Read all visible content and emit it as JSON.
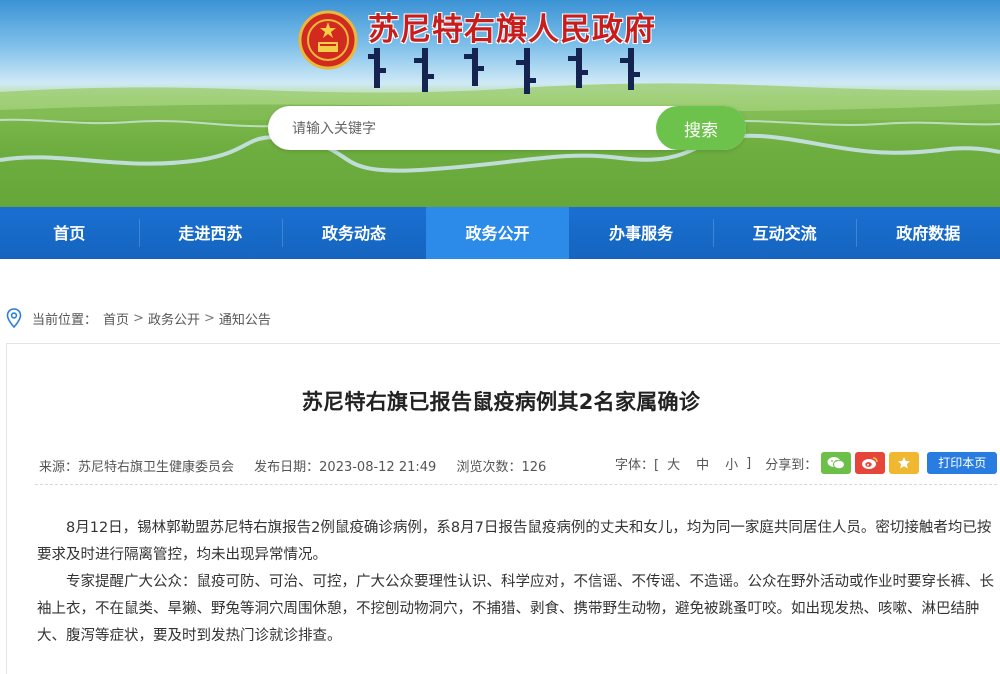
{
  "site": {
    "title": "苏尼特右旗人民政府"
  },
  "search": {
    "placeholder": "请输入关键字",
    "button_label": "搜索"
  },
  "nav": {
    "items": [
      {
        "label": "首页"
      },
      {
        "label": "走进西苏"
      },
      {
        "label": "政务动态"
      },
      {
        "label": "政务公开"
      },
      {
        "label": "办事服务"
      },
      {
        "label": "互动交流"
      },
      {
        "label": "政府数据"
      }
    ],
    "active_index": 3
  },
  "breadcrumb": {
    "prefix": "当前位置：",
    "items": [
      "首页",
      "政务公开",
      "通知公告"
    ],
    "separator": ">"
  },
  "article": {
    "title": "苏尼特右旗已报告鼠疫病例其2名家属确诊",
    "source": "来源：苏尼特右旗卫生健康委员会",
    "publish_date": "发布日期：2023-08-12 21:49",
    "views": "浏览次数：126",
    "font_label": "字体：[",
    "font_sizes": [
      "大",
      "中",
      "小"
    ],
    "font_close": "]",
    "share_label": "分享到：",
    "print_label": "打印本页",
    "paragraphs": [
      "8月12日，锡林郭勒盟苏尼特右旗报告2例鼠疫确诊病例，系8月7日报告鼠疫病例的丈夫和女儿，均为同一家庭共同居住人员。密切接触者均已按要求及时进行隔离管控，均未出现异常情况。",
      "专家提醒广大公众：鼠疫可防、可治、可控，广大公众要理性认识、科学应对，不信谣、不传谣、不造谣。公众在野外活动或作业时要穿长裤、长袖上衣，不在鼠类、旱獭、野兔等洞穴周围休憩，不挖刨动物洞穴，不捕猎、剥食、携带野生动物，避免被跳蚤叮咬。如出现发热、咳嗽、淋巴结肿大、腹泻等症状，要及时到发热门诊就诊排查。"
    ]
  },
  "colors": {
    "nav_bg": "#1565c0",
    "nav_active": "#2c8ae8",
    "search_button": "#6cc24a",
    "title_red": "#c71d1d",
    "print_button": "#2a7de0"
  },
  "icons": {
    "emblem": "national-emblem-icon",
    "location": "location-pin-icon",
    "wechat": "wechat-icon",
    "weibo": "weibo-icon",
    "favorite": "star-icon"
  }
}
